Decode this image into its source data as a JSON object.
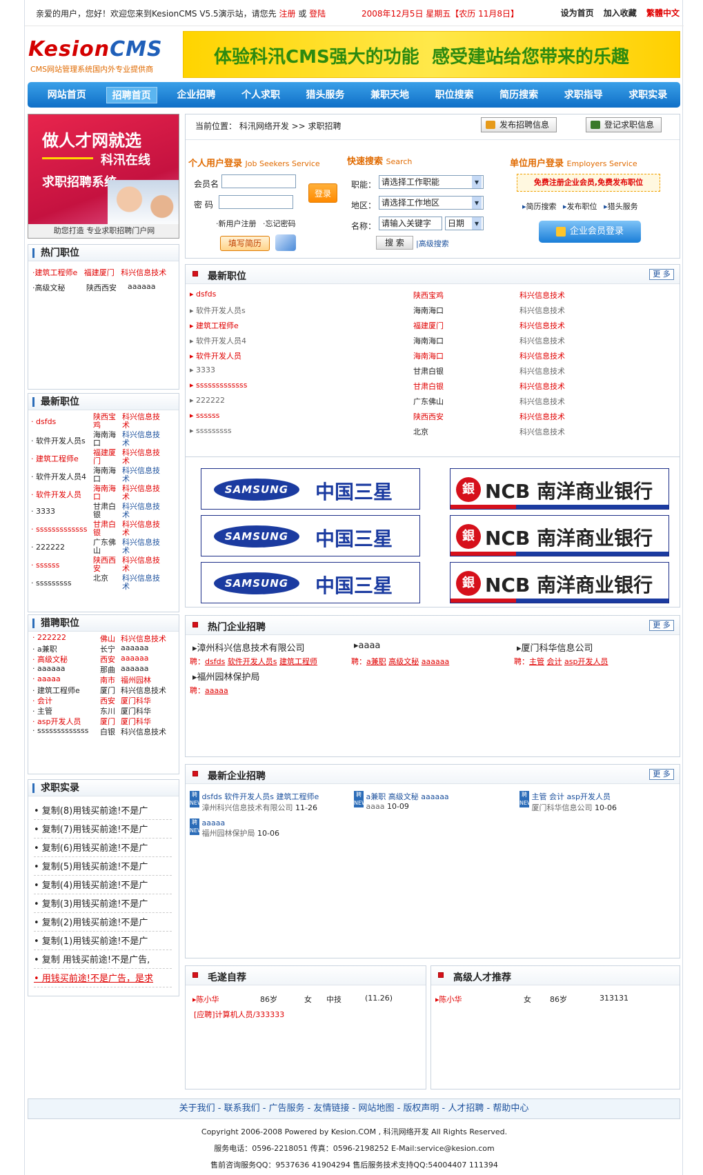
{
  "topbar": {
    "welcome": "亲爱的用户，您好！欢迎您来到KesionCMS V5.5演示站，请您先",
    "register": "注册",
    "or": "或",
    "login": "登陆",
    "date": "2008年12月5日 星期五【农历 11月8日】",
    "set_home": "设为首页",
    "favorite": "加入收藏",
    "traditional": "繁體中文"
  },
  "logo": {
    "text_k": "K",
    "text_rest": "esion",
    "text_cms": "CMS",
    "tagline": "CMS网站管理系统国内外专业提供商"
  },
  "banner": {
    "left": "体验科汛CMS强大的功能",
    "right": "感受建站给您带来的乐趣"
  },
  "nav": [
    "网站首页",
    "招聘首页",
    "企业招聘",
    "个人求职",
    "猎头服务",
    "兼职天地",
    "职位搜索",
    "简历搜索",
    "求职指导",
    "求职实录"
  ],
  "promo": {
    "line1": "做人才网就选",
    "line2": "科汛在线",
    "line3": "求职招聘系统",
    "caption": "助您打造 专业求职招聘门户网"
  },
  "hot_jobs": {
    "title": "热门职位",
    "rows": [
      {
        "a": "建筑工程师e",
        "b": "福建厦门",
        "c": "科兴信息技术"
      },
      {
        "a": "高级文秘",
        "b": "陕西西安",
        "c": "aaaaaa"
      }
    ]
  },
  "latest_left": {
    "title": "最新职位",
    "rows": [
      {
        "a": "dsfds",
        "b": "陕西宝鸡",
        "c": "科兴信息技术"
      },
      {
        "a": "软件开发人员s",
        "b": "海南海口",
        "c": "科兴信息技术"
      },
      {
        "a": "建筑工程师e",
        "b": "福建厦门",
        "c": "科兴信息技术"
      },
      {
        "a": "软件开发人员4",
        "b": "海南海口",
        "c": "科兴信息技术"
      },
      {
        "a": "软件开发人员",
        "b": "海南海口",
        "c": "科兴信息技术"
      },
      {
        "a": "3333",
        "b": "甘肃白银",
        "c": "科兴信息技术"
      },
      {
        "a": "sssssssssssss",
        "b": "甘肃白银",
        "c": "科兴信息技术"
      },
      {
        "a": "222222",
        "b": "广东佛山",
        "c": "科兴信息技术"
      },
      {
        "a": "ssssss",
        "b": "陕西西安",
        "c": "科兴信息技术"
      },
      {
        "a": "sssssssss",
        "b": "北京",
        "c": "科兴信息技术"
      }
    ]
  },
  "headhunt": {
    "title": "猎聘职位",
    "rows": [
      {
        "a": "222222",
        "b": "佛山",
        "c": "科兴信息技术"
      },
      {
        "a": "a兼职",
        "b": "长宁",
        "c": "aaaaaa"
      },
      {
        "a": "高级文秘",
        "b": "西安",
        "c": "aaaaaa"
      },
      {
        "a": "aaaaaa",
        "b": "那曲",
        "c": "aaaaaa"
      },
      {
        "a": "aaaaa",
        "b": "南市",
        "c": "福州园林"
      },
      {
        "a": "建筑工程师e",
        "b": "厦门",
        "c": "科兴信息技术"
      },
      {
        "a": "会计",
        "b": "西安",
        "c": "厦门科华"
      },
      {
        "a": "主管",
        "b": "东川",
        "c": "厦门科华"
      },
      {
        "a": "asp开发人员",
        "b": "厦门",
        "c": "厦门科华"
      },
      {
        "a": "sssssssssssss",
        "b": "白银",
        "c": "科兴信息技术"
      }
    ]
  },
  "records": {
    "title": "求职实录",
    "items": [
      "复制(8)用钱买前途!不是广",
      "复制(7)用钱买前途!不是广",
      "复制(6)用钱买前途!不是广",
      "复制(5)用钱买前途!不是广",
      "复制(4)用钱买前途!不是广",
      "复制(3)用钱买前途!不是广",
      "复制(2)用钱买前途!不是广",
      "复制(1)用钱买前途!不是广",
      "复制 用钱买前途!不是广告,",
      "用钱买前途!不是广告，是求"
    ]
  },
  "main": {
    "crumb": "当前位置：  科汛网络开发  >> 求职招聘",
    "post_btn": "发布招聘信息",
    "register_btn": "登记求职信息",
    "person_login": {
      "title": "个人用户登录",
      "en": "Job Seekers Service",
      "user_label": "会员名",
      "pwd_label": "密  码",
      "login_btn": "登录",
      "new_user": "新用户注册",
      "forgot": "忘记密码",
      "resume_btn": "填写简历"
    },
    "search": {
      "title": "快速搜索",
      "en": "Search",
      "job_label": "职能：",
      "job_value": "请选择工作职能",
      "area_label": "地区：",
      "area_value": "请选择工作地区",
      "name_label": "名称：",
      "keyword": "请输入关键字",
      "date": "日期",
      "search_btn": "搜 索",
      "adv": "高级搜索"
    },
    "company_login": {
      "title": "单位用户登录",
      "en": "Employers Service",
      "promo": "免费注册企业会员,免费发布职位",
      "link1": "简历搜索",
      "link2": "发布职位",
      "link3": "猎头服务",
      "login_btn": "企业会员登录"
    }
  },
  "latest": {
    "title": "最新职位",
    "more": "更 多",
    "rows": [
      {
        "a": "dsfds",
        "b": "陕西宝鸡",
        "c": "科兴信息技术",
        "red": true
      },
      {
        "a": "软件开发人员s",
        "b": "海南海口",
        "c": "科兴信息技术",
        "red": false
      },
      {
        "a": "建筑工程师e",
        "b": "福建厦门",
        "c": "科兴信息技术",
        "red": true
      },
      {
        "a": "软件开发人员4",
        "b": "海南海口",
        "c": "科兴信息技术",
        "red": false
      },
      {
        "a": "软件开发人员",
        "b": "海南海口",
        "c": "科兴信息技术",
        "red": true
      },
      {
        "a": "3333",
        "b": "甘肃白银",
        "c": "科兴信息技术",
        "red": false
      },
      {
        "a": "sssssssssssss",
        "b": "甘肃白银",
        "c": "科兴信息技术",
        "red": true
      },
      {
        "a": "222222",
        "b": "广东佛山",
        "c": "科兴信息技术",
        "red": false
      },
      {
        "a": "ssssss",
        "b": "陕西西安",
        "c": "科兴信息技术",
        "red": true
      },
      {
        "a": "sssssssss",
        "b": "北京",
        "c": "科兴信息技术",
        "red": false
      }
    ]
  },
  "sponsors": {
    "samsung_logo": "SAMSUNG",
    "samsung_cn": "中国三星",
    "ncb_logo": "NCB",
    "ncb_cn": "南洋商业银行"
  },
  "hot_company": {
    "title": "热门企业招聘",
    "more": "更 多",
    "companies": [
      {
        "name": "漳州科兴信息技术有限公司",
        "label": "聘：",
        "jobs": [
          "dsfds",
          "软件开发人员s",
          "建筑工程师"
        ]
      },
      {
        "name": "aaaa",
        "label": "聘：",
        "jobs": [
          "a兼职",
          "高级文秘",
          "aaaaaa"
        ]
      },
      {
        "name": "厦门科华信息公司",
        "label": "聘：",
        "jobs": [
          "主管",
          "会计",
          "asp开发人员"
        ]
      },
      {
        "name": "福州园林保护局",
        "label": "聘：",
        "jobs": [
          "aaaaa"
        ]
      }
    ]
  },
  "latest_company": {
    "title": "最新企业招聘",
    "more": "更 多",
    "items": [
      {
        "jobs": "dsfds 软件开发人员s 建筑工程师e",
        "company": "漳州科兴信息技术有限公司",
        "date": "11-26"
      },
      {
        "jobs": "a兼职  高级文秘  aaaaaa",
        "company": "aaaa",
        "date": "10-09"
      },
      {
        "jobs": "主管  会计  asp开发人员",
        "company": "厦门科华信息公司",
        "date": "10-06"
      },
      {
        "jobs": "aaaaa",
        "company": "福州园林保护局",
        "date": "10-06"
      }
    ]
  },
  "self_rec": {
    "title": "毛遂自荐",
    "name": "陈小华",
    "age": "86岁",
    "gender": "女",
    "edu": "中技",
    "date": "(11.26)",
    "apply": "[应聘]计算机人员/333333"
  },
  "talent": {
    "title": "高级人才推荐",
    "name": "陈小华",
    "gender": "女",
    "age": "86岁",
    "code": "313131"
  },
  "footer": {
    "links": "关于我们 - 联系我们 - 广告服务 - 友情链接 - 网站地图 - 版权声明 - 人才招聘 - 帮助中心",
    "copyright": "Copyright 2006-2008 Powered by Kesion.COM , 科汛网络开发  All Rights Reserved.",
    "phone": "服务电话：0596-2218051 传真：0596-2198252 E-Mail:service@kesion.com",
    "qq": "售前咨询服务QQ：9537636 41904294 售后服务技术支持QQ:54004407 111394"
  }
}
